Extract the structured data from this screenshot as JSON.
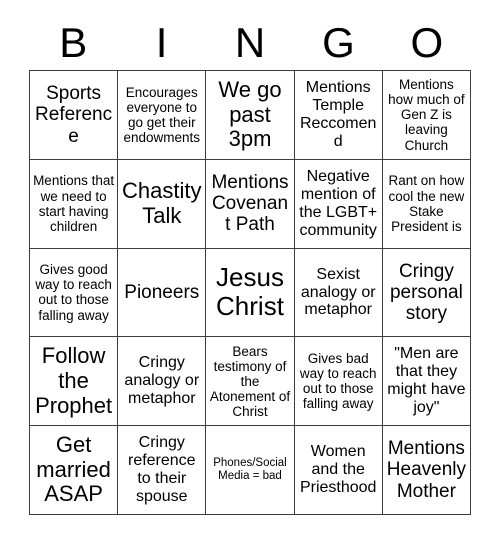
{
  "card": {
    "title_letters": [
      "B",
      "I",
      "N",
      "G",
      "O"
    ],
    "grid": {
      "rows": 5,
      "columns": 5,
      "border_color": "#3c3c3c",
      "background_color": "#ffffff",
      "text_color": "#000000"
    },
    "cells": [
      {
        "text": "Sports Reference",
        "size": "lg"
      },
      {
        "text": "Encourages everyone to go get their endowments",
        "size": "sm"
      },
      {
        "text": "We go past 3pm",
        "size": "xl"
      },
      {
        "text": "Mentions Temple Reccomend",
        "size": "md"
      },
      {
        "text": "Mentions how much of Gen Z is leaving Church",
        "size": "sm"
      },
      {
        "text": "Mentions that we need to start having children",
        "size": "sm"
      },
      {
        "text": "Chastity Talk",
        "size": "xl"
      },
      {
        "text": "Mentions Covenant Path",
        "size": "lg"
      },
      {
        "text": "Negative mention of the LGBT+ community",
        "size": "md"
      },
      {
        "text": "Rant on how cool the new Stake President is",
        "size": "sm"
      },
      {
        "text": "Gives good way to reach out to those falling away",
        "size": "sm"
      },
      {
        "text": "Pioneers",
        "size": "lg"
      },
      {
        "text": "Jesus Christ",
        "size": "xxl"
      },
      {
        "text": "Sexist analogy or metaphor",
        "size": "md"
      },
      {
        "text": "Cringy personal story",
        "size": "lg"
      },
      {
        "text": "Follow the Prophet",
        "size": "xl"
      },
      {
        "text": "Cringy analogy or metaphor",
        "size": "md"
      },
      {
        "text": "Bears testimony of the Atonement of Christ",
        "size": "sm"
      },
      {
        "text": "Gives bad way to reach out to those falling away",
        "size": "sm"
      },
      {
        "text": "\"Men are that they might have joy\"",
        "size": "md"
      },
      {
        "text": "Get married ASAP",
        "size": "xl"
      },
      {
        "text": "Cringy reference to their spouse",
        "size": "md"
      },
      {
        "text": "Phones/Social Media = bad",
        "size": "xs"
      },
      {
        "text": "Women and the Priesthood",
        "size": "md"
      },
      {
        "text": "Mentions Heavenly Mother",
        "size": "lg"
      }
    ]
  }
}
